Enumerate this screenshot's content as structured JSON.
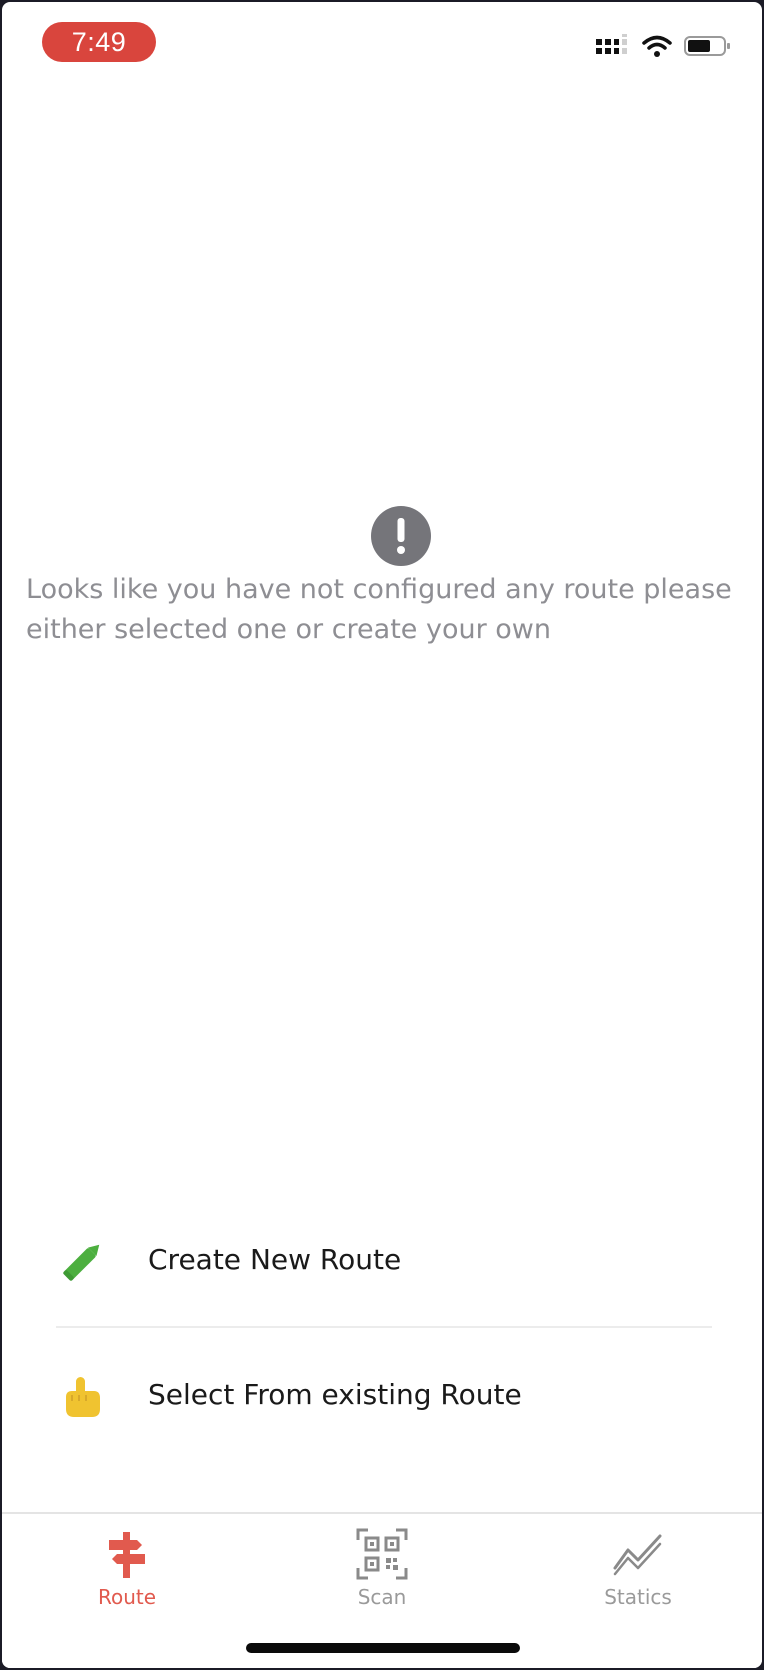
{
  "status_bar": {
    "time": "7:49",
    "time_pill_color": "#d9453d",
    "icons": [
      "signal-icon",
      "wifi-icon",
      "battery-icon"
    ]
  },
  "empty_state": {
    "icon": "exclamation-circle-icon",
    "message": "Looks like you have not configured any route please\neither selected one or create your own",
    "text_color": "#8e8e93"
  },
  "actions": [
    {
      "icon": "pencil-icon",
      "label": "Create New Route",
      "icon_color": "#4caf3f"
    },
    {
      "icon": "pointing-hand-icon",
      "label": "Select From existing Route",
      "icon_color": "#f0c330"
    }
  ],
  "tab_bar": {
    "active_color": "#e15a4e",
    "inactive_color": "#9a9a9a",
    "tabs": [
      {
        "label": "Route",
        "icon": "signpost-icon",
        "active": true
      },
      {
        "label": "Scan",
        "icon": "qr-code-icon",
        "active": false
      },
      {
        "label": "Statics",
        "icon": "line-chart-icon",
        "active": false
      }
    ]
  }
}
